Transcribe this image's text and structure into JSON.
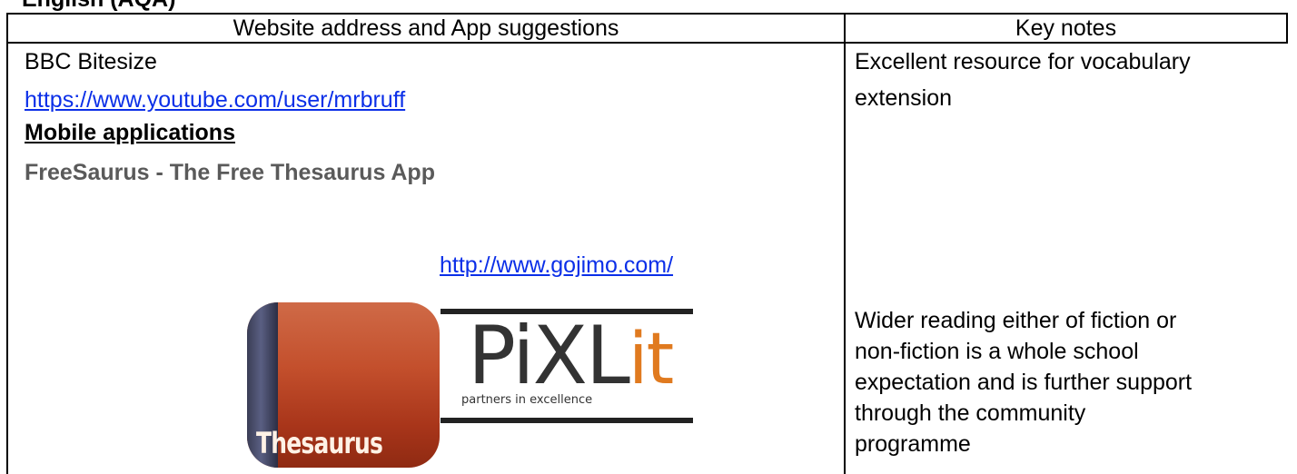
{
  "heading": "English (AQA)",
  "table": {
    "headers": [
      "Website address and App suggestions",
      "Key notes"
    ],
    "left": {
      "line1": "BBC Bitesize",
      "link1": "https://www.youtube.com/user/mrbruff",
      "subheading": "Mobile applications",
      "app_name": "FreeSaurus - The Free Thesaurus App",
      "link2": "http://www.gojimo.com/"
    },
    "right": {
      "note1_line1": "Excellent resource for vocabulary",
      "note1_line2": "extension",
      "note2_lines": [
        "Wider reading either of fiction or",
        "non-fiction is a whole school",
        "expectation and is further support",
        "through the community",
        "programme"
      ]
    }
  },
  "logos": {
    "thesaurus_label": "Thesaurus",
    "pixl_main": "PiXL",
    "pixl_suffix": "it",
    "pixl_tagline": "partners in excellence"
  }
}
